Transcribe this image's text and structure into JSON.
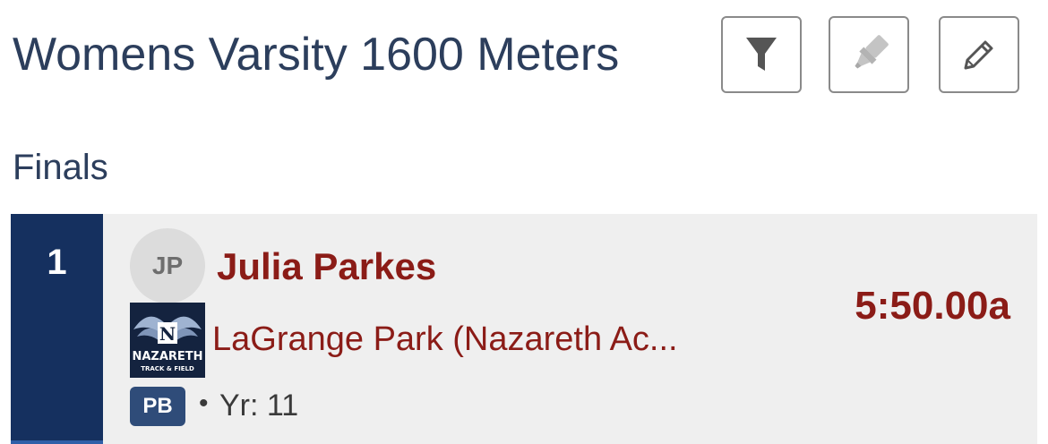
{
  "header": {
    "title": "Womens Varsity 1600 Meters",
    "buttons": [
      {
        "name": "filter",
        "icon": "filter-icon"
      },
      {
        "name": "highlight",
        "icon": "highlighter-icon"
      },
      {
        "name": "edit",
        "icon": "pencil-icon"
      }
    ]
  },
  "section": {
    "heading": "Finals"
  },
  "results": [
    {
      "place": "1",
      "initials": "JP",
      "athlete": "Julia Parkes",
      "team": "LaGrange Park (Nazareth Ac...",
      "team_logo": {
        "letter": "N",
        "line1": "NAZARETH",
        "line2": "TRACK & FIELD"
      },
      "mark": "5:50.00a",
      "badge": "PB",
      "bullet": "•",
      "year": "Yr: 11"
    }
  ],
  "colors": {
    "title": "#2c3e5c",
    "place_bg": "#15305f",
    "accent_red": "#8b1c17",
    "badge_bg": "#2f4c79",
    "card_bg": "#efefef"
  }
}
